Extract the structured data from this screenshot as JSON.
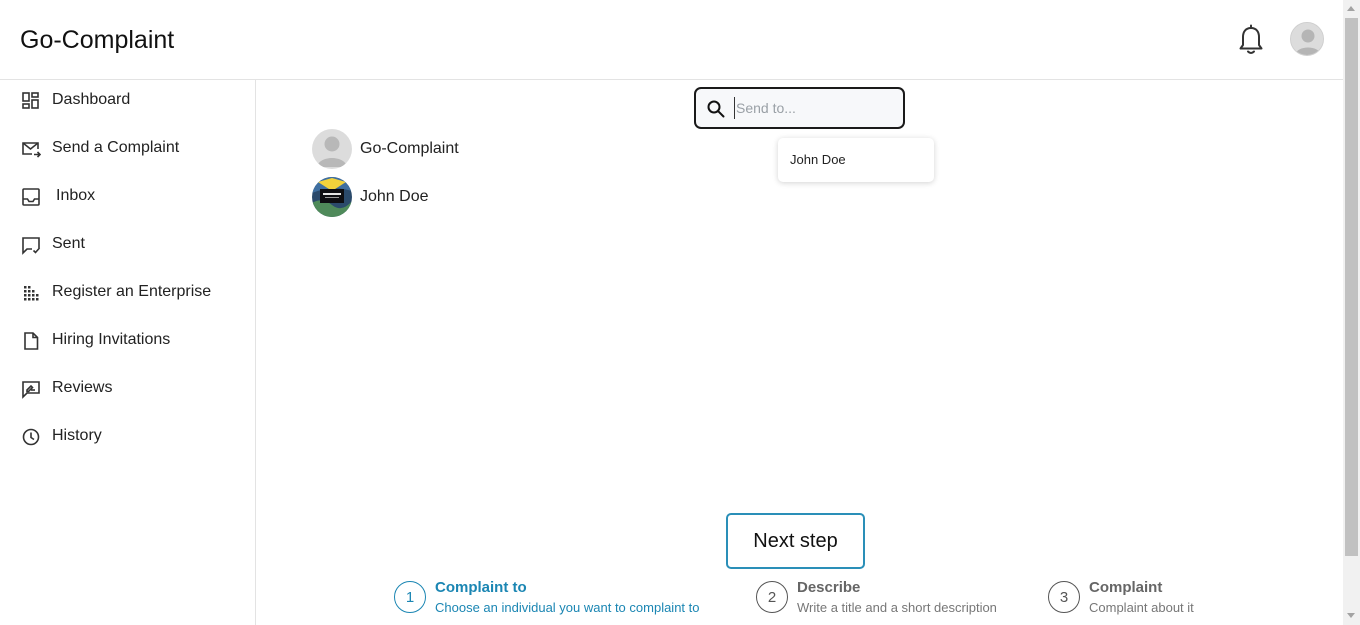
{
  "app": {
    "title": "Go-Complaint"
  },
  "header": {
    "notifications_icon": "bell-icon",
    "profile_icon": "avatar-icon"
  },
  "sidebar": {
    "items": [
      {
        "label": "Dashboard",
        "icon": "dashboard-icon"
      },
      {
        "label": "Send a Complaint",
        "icon": "send-mail-icon"
      },
      {
        "label": "Inbox",
        "icon": "inbox-icon"
      },
      {
        "label": "Sent",
        "icon": "sent-icon"
      },
      {
        "label": "Register an Enterprise",
        "icon": "building-icon"
      },
      {
        "label": "Hiring Invitations",
        "icon": "document-icon"
      },
      {
        "label": "Reviews",
        "icon": "review-icon"
      },
      {
        "label": "History",
        "icon": "clock-icon"
      }
    ]
  },
  "search": {
    "placeholder": "Send to...",
    "value": "",
    "icon": "search-icon"
  },
  "dropdown": {
    "options": [
      "John Doe"
    ]
  },
  "contacts": [
    {
      "name": "Go-Complaint",
      "avatar": "default-avatar"
    },
    {
      "name": "John Doe",
      "avatar": "van-gogh-avatar"
    }
  ],
  "next_button": {
    "label": "Next step"
  },
  "steps": [
    {
      "number": "1",
      "title": "Complaint to",
      "description": "Choose an individual you want to complaint to",
      "active": true
    },
    {
      "number": "2",
      "title": "Describe",
      "description": "Write a title and a short description",
      "active": false
    },
    {
      "number": "3",
      "title": "Complaint",
      "description": "Complaint about it",
      "active": false
    }
  ],
  "colors": {
    "accent": "#1b86b3",
    "button_border": "#2a8fb8",
    "divider": "#e3e3e3"
  }
}
